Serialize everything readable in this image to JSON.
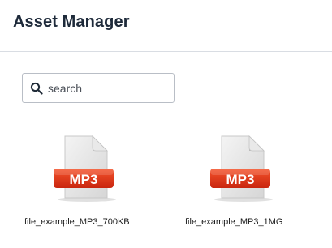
{
  "header": {
    "title": "Asset Manager"
  },
  "search": {
    "placeholder": "search",
    "value": ""
  },
  "assets": [
    {
      "name": "file_example_MP3_700KB",
      "type_label": "MP3",
      "icon": "mp3-file-icon"
    },
    {
      "name": "file_example_MP3_1MG",
      "type_label": "MP3",
      "icon": "mp3-file-icon"
    }
  ],
  "colors": {
    "badge": "#e23b1e",
    "title": "#1e2a3a"
  }
}
